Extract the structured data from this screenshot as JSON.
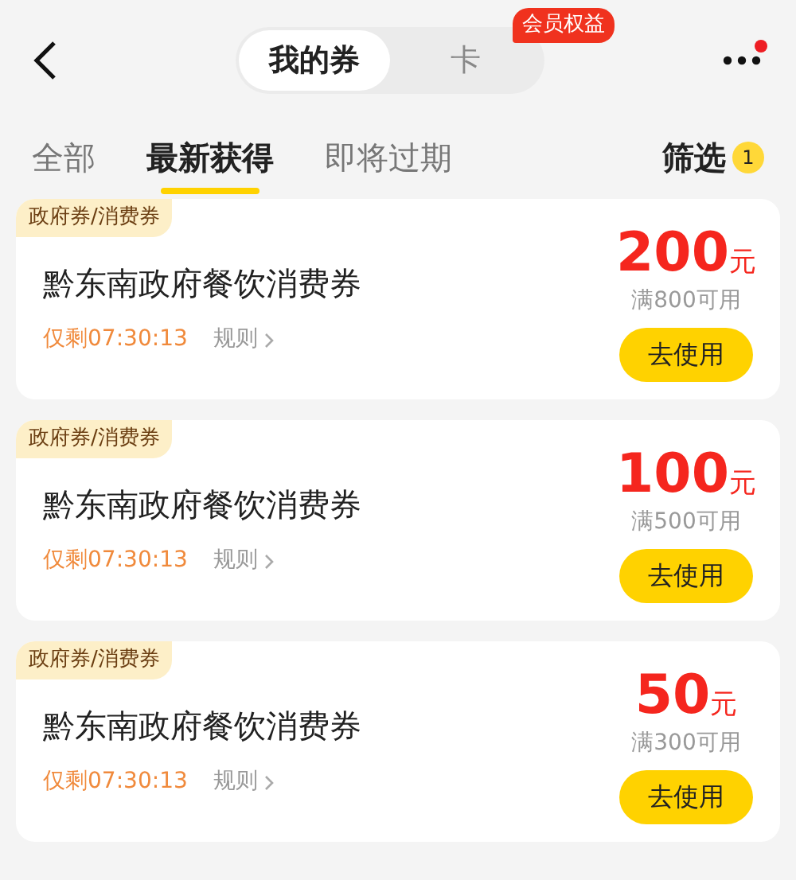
{
  "header": {
    "segments": [
      {
        "label": "我的券",
        "selected": true
      },
      {
        "label": "卡",
        "selected": false
      }
    ],
    "promo_badge": "会员权益",
    "menu_dot": true
  },
  "tabs": [
    {
      "label": "全部",
      "selected": false
    },
    {
      "label": "最新获得",
      "selected": true
    },
    {
      "label": "即将过期",
      "selected": false
    }
  ],
  "filter": {
    "label": "筛选",
    "count": "1"
  },
  "coupons": [
    {
      "tag": "政府券/消费券",
      "title": "黔东南政府餐饮消费券",
      "countdown": "仅剩07:30:13",
      "rules": "规则",
      "amount": "200",
      "unit": "元",
      "condition": "满800可用",
      "button": "去使用"
    },
    {
      "tag": "政府券/消费券",
      "title": "黔东南政府餐饮消费券",
      "countdown": "仅剩07:30:13",
      "rules": "规则",
      "amount": "100",
      "unit": "元",
      "condition": "满500可用",
      "button": "去使用"
    },
    {
      "tag": "政府券/消费券",
      "title": "黔东南政府餐饮消费券",
      "countdown": "仅剩07:30:13",
      "rules": "规则",
      "amount": "50",
      "unit": "元",
      "condition": "满300可用",
      "button": "去使用"
    }
  ]
}
